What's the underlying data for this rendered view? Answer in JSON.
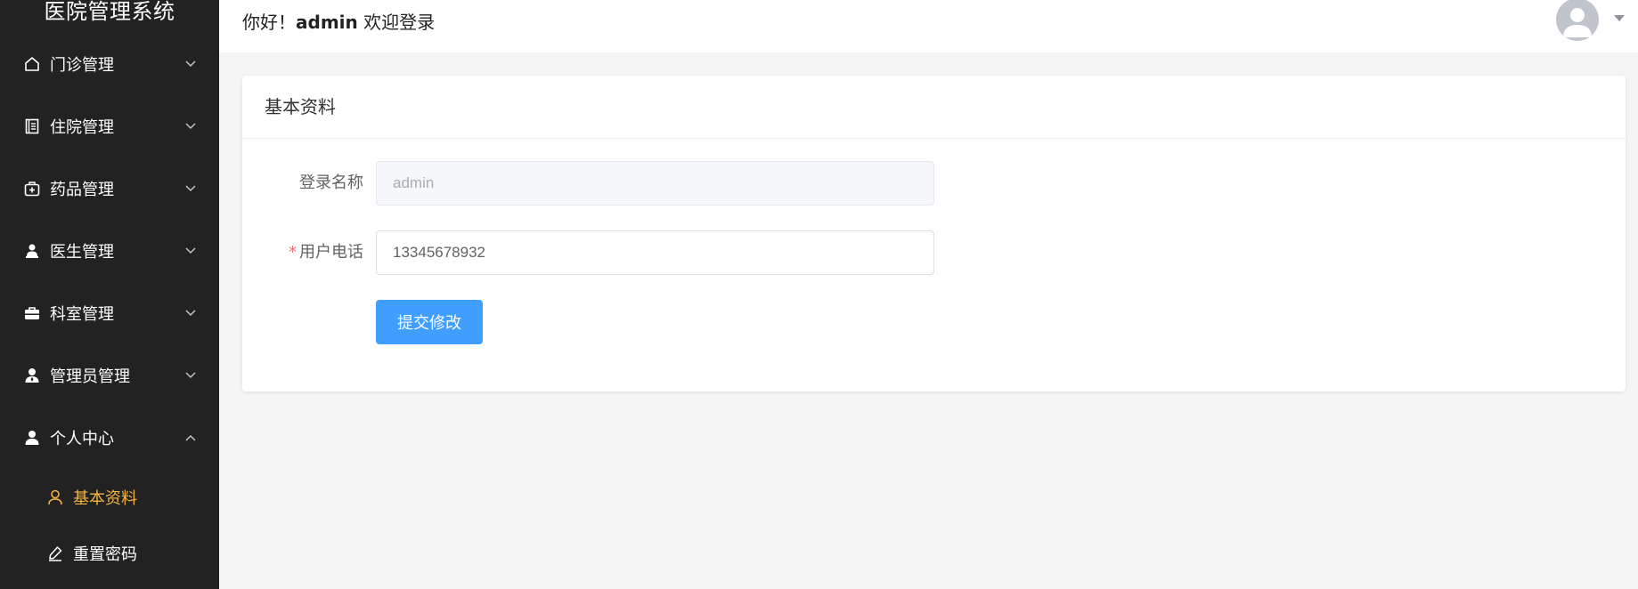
{
  "app": {
    "title": "医院管理系统"
  },
  "colors": {
    "sidebar_bg": "#222222",
    "active_submenu": "#f5b53f",
    "primary": "#409eff",
    "required": "#f56c6c"
  },
  "sidebar": {
    "items": [
      {
        "label": "门诊管理",
        "icon": "home-icon",
        "expanded": false
      },
      {
        "label": "住院管理",
        "icon": "document-icon",
        "expanded": false
      },
      {
        "label": "药品管理",
        "icon": "medicine-kit-icon",
        "expanded": false
      },
      {
        "label": "医生管理",
        "icon": "doctor-icon",
        "expanded": false
      },
      {
        "label": "科室管理",
        "icon": "briefcase-icon",
        "expanded": false
      },
      {
        "label": "管理员管理",
        "icon": "admin-user-icon",
        "expanded": false
      },
      {
        "label": "个人中心",
        "icon": "user-icon",
        "expanded": true
      }
    ],
    "subitems": [
      {
        "label": "基本资料",
        "icon": "user-outline-icon",
        "active": true
      },
      {
        "label": "重置密码",
        "icon": "edit-pen-icon",
        "active": false
      }
    ]
  },
  "header": {
    "greeting_prefix": "你好！",
    "username": "admin",
    "greeting_suffix": " 欢迎登录"
  },
  "card": {
    "title": "基本资料",
    "form": {
      "login_name_label": "登录名称",
      "login_name_value": "admin",
      "phone_required_mark": "*",
      "phone_label": "用户电话",
      "phone_value": "13345678932",
      "submit_label": "提交修改"
    }
  }
}
